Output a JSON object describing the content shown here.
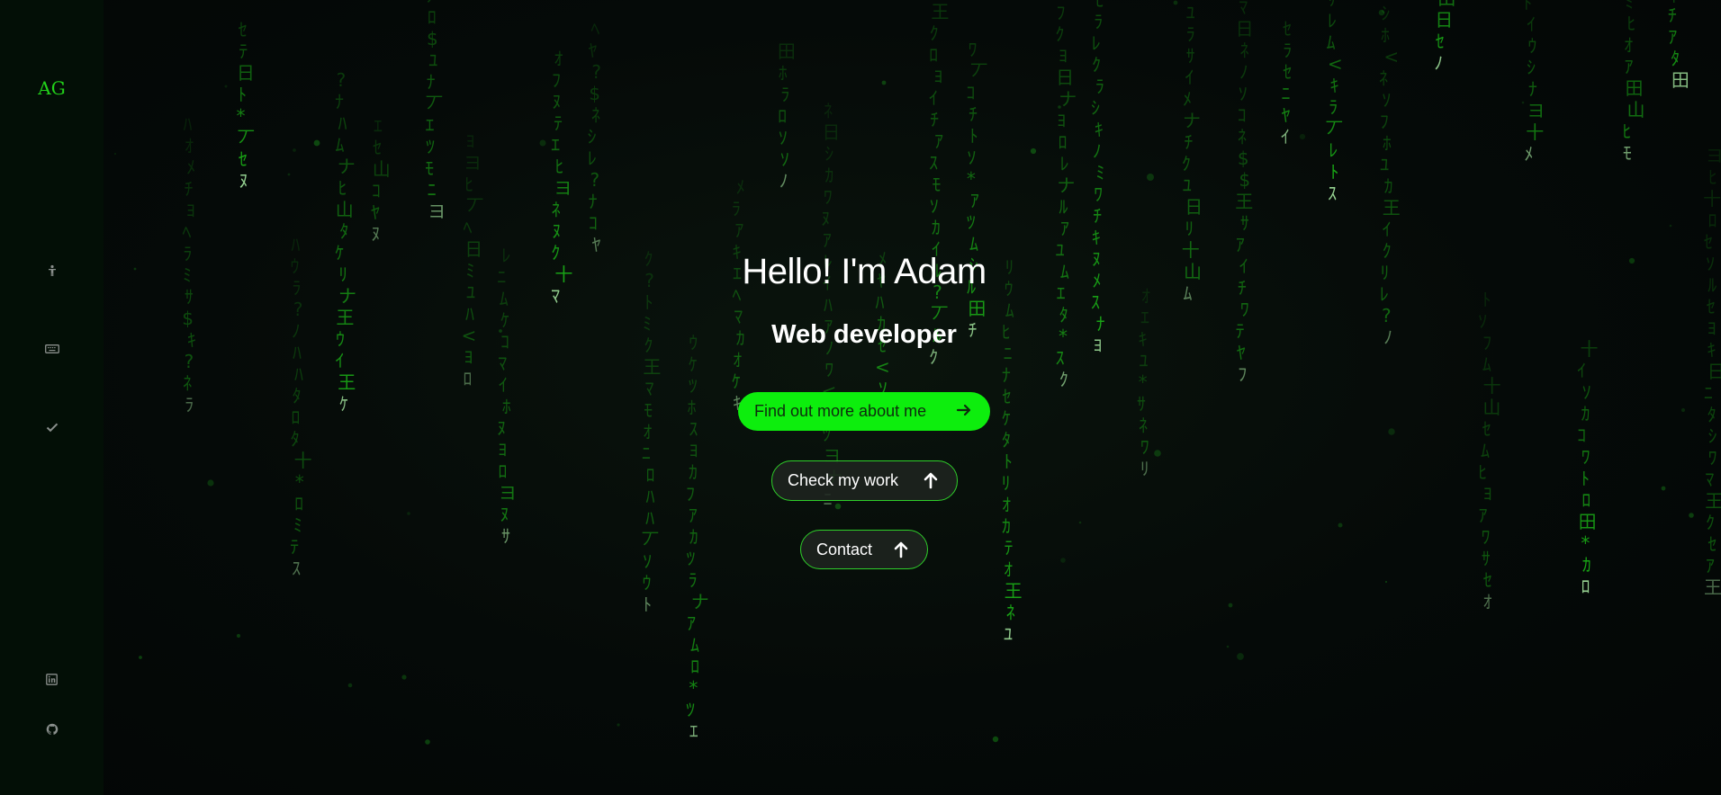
{
  "sidebar": {
    "logo": "AG",
    "nav": [
      {
        "icon": "person-icon"
      },
      {
        "icon": "keyboard-icon"
      },
      {
        "icon": "check-icon"
      }
    ],
    "social": [
      {
        "icon": "linkedin-icon"
      },
      {
        "icon": "github-icon"
      }
    ]
  },
  "hero": {
    "title": "Hello! I'm Adam",
    "subtitle": "Web developer",
    "buttons": {
      "about": "Find out more about me",
      "work": "Check my work",
      "contact": "Contact"
    }
  },
  "colors": {
    "accent": "#0dee0d",
    "sidebar_bg": "#030f06",
    "background": "#05090a",
    "logo": "#22d11a"
  }
}
